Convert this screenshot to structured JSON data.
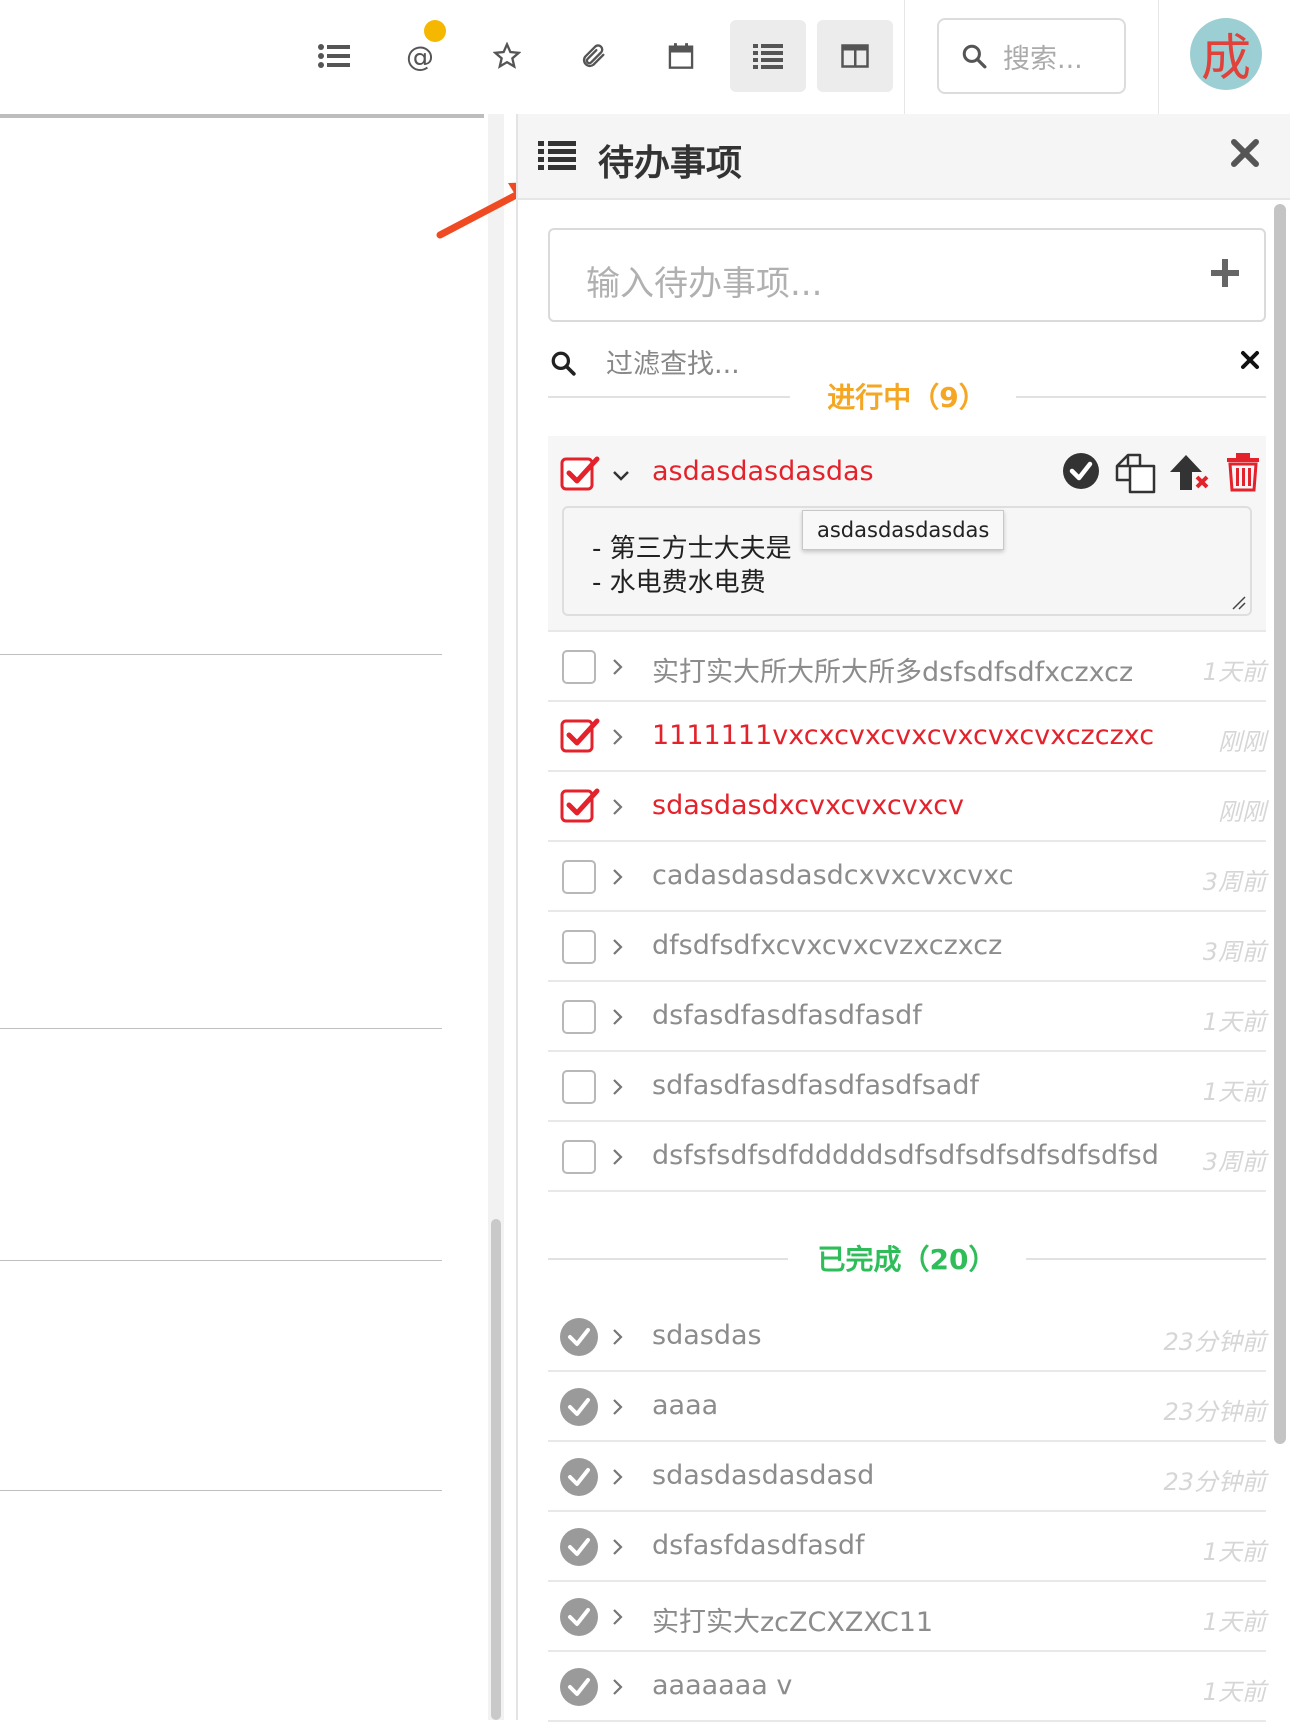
{
  "toolbar": {
    "icons": [
      "list-icon",
      "mention-icon",
      "star-icon",
      "attachment-icon",
      "calendar-icon",
      "todo-list-icon",
      "split-view-icon"
    ],
    "notification_color": "#f5b700",
    "search_placeholder": "搜索...",
    "avatar_text": "成",
    "avatar_bg": "#9ccfd3",
    "avatar_color": "#e0413a"
  },
  "panel": {
    "title": "待办事项",
    "add_placeholder": "输入待办事项...",
    "filter_placeholder": "过滤查找..."
  },
  "in_progress": {
    "heading": "进行中（9）",
    "color": "#f5a623",
    "expanded": {
      "label": "asdasdasdasdas",
      "checked": true,
      "note_lines": [
        "- 第三方士大夫是",
        "- 水电费水电费"
      ],
      "tooltip": "asdasdasdasdas"
    },
    "items": [
      {
        "label": "实打实大所大所大所多dsfsdfsdfxczxcz",
        "time": "1天前",
        "checked": false
      },
      {
        "label": "1111111vxcxcvxcvxcvxcvxcvxczczxc",
        "time": "刚刚",
        "checked": true
      },
      {
        "label": "sdasdasdxcvxcvxcvxcv",
        "time": "刚刚",
        "checked": true
      },
      {
        "label": "cadasdasdasdcxvxcvxcvxc",
        "time": "3周前",
        "checked": false
      },
      {
        "label": "dfsdfsdfxcvxcvxcvzxczxcz",
        "time": "3周前",
        "checked": false
      },
      {
        "label": "dsfasdfasdfasdfasdf",
        "time": "1天前",
        "checked": false
      },
      {
        "label": "sdfasdfasdfasdfasdfsadf",
        "time": "1天前",
        "checked": false
      },
      {
        "label": "dsfsfsdfsdfdddddsdfsdfsdfsdfsdfsdfsd",
        "time": "3周前",
        "checked": false
      }
    ]
  },
  "completed": {
    "heading": "已完成（20）",
    "color": "#2ebd59",
    "items": [
      {
        "label": "sdasdas",
        "time": "23分钟前"
      },
      {
        "label": "aaaa",
        "time": "23分钟前"
      },
      {
        "label": "sdasdasdasdasd",
        "time": "23分钟前"
      },
      {
        "label": "dsfasfdasdfasdf",
        "time": "1天前"
      },
      {
        "label": "实打实大zcZCXZXC11",
        "time": "1天前"
      },
      {
        "label": "aaaaaaa v",
        "time": "1天前"
      }
    ]
  },
  "annotation": {
    "arrow_color": "#f04a23"
  }
}
